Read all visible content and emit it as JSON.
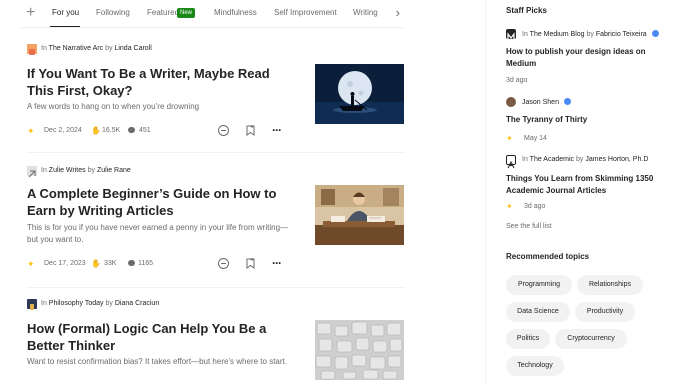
{
  "tabs": {
    "add_label": "+",
    "items": [
      "For you",
      "Following",
      "Featured",
      "Mindfulness",
      "Self Improvement",
      "Writing"
    ],
    "active": "For you",
    "new_badge": "New",
    "next_icon": "chevron-right-icon"
  },
  "articles": [
    {
      "pub_prefix": "In",
      "publication": "The Narrative Arc",
      "by": "by",
      "author": "Linda Caroll",
      "title": "If You Want To Be a Writer, Maybe Read This First, Okay?",
      "subtitle": "A few words to hang on to when you’re drowning",
      "date": "Dec 2, 2024",
      "claps": "16.5K",
      "responses": "451",
      "thumbnail": "moonlit-boat-illustration",
      "logo_color": "#e8743b"
    },
    {
      "pub_prefix": "In",
      "publication": "Zulie Writes",
      "by": "by",
      "author": "Zulie Rane",
      "title": "A Complete Beginner’s Guide on How to Earn by Writing Articles",
      "subtitle": "This is for you if you have never earned a penny in your life from writing—but you want to.",
      "date": "Dec 17, 2023",
      "claps": "33K",
      "responses": "1165",
      "thumbnail": "writer-at-desk-illustration",
      "logo_color": "#b8b8b8"
    },
    {
      "pub_prefix": "In",
      "publication": "Philosophy Today",
      "by": "by",
      "author": "Diana Craciun",
      "title": "How (Formal) Logic Can Help You Be a Better Thinker",
      "subtitle": "Want to resist confirmation bias? It takes effort—but here’s where to start.",
      "thumbnail": "puzzle-pieces-photo",
      "logo_color": "#2b3a55"
    }
  ],
  "sidebar": {
    "staff_picks_heading": "Staff Picks",
    "picks": [
      {
        "prefix": "In",
        "publication": "The Medium Blog",
        "by": "by",
        "author": "Fabricio Teixeira",
        "title": "How to publish your design ideas on Medium",
        "meta": "3d ago",
        "starred": false
      },
      {
        "prefix": "",
        "publication": "",
        "by": "",
        "author": "Jason Shen",
        "title": "The Tyranny of Thirty",
        "meta": "May 14",
        "starred": true
      },
      {
        "prefix": "In",
        "publication": "The Academic",
        "by": "by",
        "author": "James Horton, Ph.D",
        "title": "Things You Learn from Skimming 1350 Academic Journal Articles",
        "meta": "3d ago",
        "starred": true
      }
    ],
    "full_list": "See the full list",
    "recommended_heading": "Recommended topics",
    "topics": [
      "Programming",
      "Relationships",
      "Data Science",
      "Productivity",
      "Politics",
      "Cryptocurrency",
      "Technology"
    ]
  },
  "colors": {
    "accent_green": "#1a8917",
    "star": "#ffc017",
    "verified": "#4a8af4",
    "chip_bg": "#f2f2f2"
  }
}
